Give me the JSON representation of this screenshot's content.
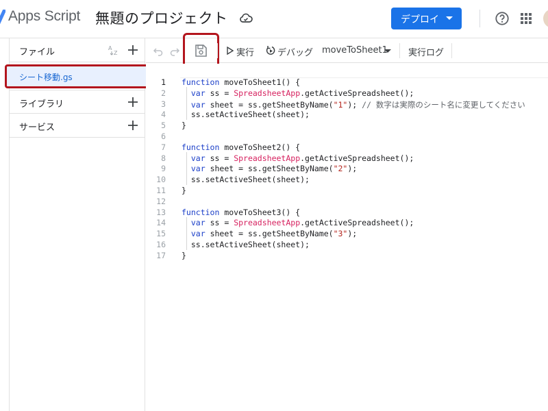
{
  "header": {
    "app_title": "Apps Script",
    "project_title": "無題のプロジェクト",
    "deploy_label": "デプロイ"
  },
  "sidebar": {
    "files_label": "ファイル",
    "sort_label": "AZ",
    "file_item": "シート移動.gs",
    "library_label": "ライブラリ",
    "services_label": "サービス"
  },
  "toolbar": {
    "run_label": "実行",
    "debug_label": "デバッグ",
    "function_select": "moveToSheet1",
    "log_label": "実行ログ"
  },
  "code": {
    "line_numbers": [
      "1",
      "2",
      "3",
      "4",
      "5",
      "6",
      "7",
      "8",
      "9",
      "10",
      "11",
      "12",
      "13",
      "14",
      "15",
      "16",
      "17"
    ],
    "lines": [
      [
        {
          "t": "function",
          "c": "kw"
        },
        {
          "t": " moveToSheet1() {"
        }
      ],
      [
        {
          "t": "  "
        },
        {
          "t": "var",
          "c": "kw"
        },
        {
          "t": " ss = "
        },
        {
          "t": "SpreadsheetApp",
          "c": "cls"
        },
        {
          "t": ".getActiveSpreadsheet();"
        }
      ],
      [
        {
          "t": "  "
        },
        {
          "t": "var",
          "c": "kw"
        },
        {
          "t": " sheet = ss.getSheetByName("
        },
        {
          "t": "\"1\"",
          "c": "str"
        },
        {
          "t": "); "
        },
        {
          "t": "// 数字は実際のシート名に変更してください",
          "c": "cmt"
        }
      ],
      [
        {
          "t": "  ss.setActiveSheet(sheet);"
        }
      ],
      [
        {
          "t": "}"
        }
      ],
      [
        {
          "t": ""
        }
      ],
      [
        {
          "t": "function",
          "c": "kw"
        },
        {
          "t": " moveToSheet2() {"
        }
      ],
      [
        {
          "t": "  "
        },
        {
          "t": "var",
          "c": "kw"
        },
        {
          "t": " ss = "
        },
        {
          "t": "SpreadsheetApp",
          "c": "cls"
        },
        {
          "t": ".getActiveSpreadsheet();"
        }
      ],
      [
        {
          "t": "  "
        },
        {
          "t": "var",
          "c": "kw"
        },
        {
          "t": " sheet = ss.getSheetByName("
        },
        {
          "t": "\"2\"",
          "c": "str"
        },
        {
          "t": ");"
        }
      ],
      [
        {
          "t": "  ss.setActiveSheet(sheet);"
        }
      ],
      [
        {
          "t": "}"
        }
      ],
      [
        {
          "t": ""
        }
      ],
      [
        {
          "t": "function",
          "c": "kw"
        },
        {
          "t": " moveToSheet3() {"
        }
      ],
      [
        {
          "t": "  "
        },
        {
          "t": "var",
          "c": "kw"
        },
        {
          "t": " ss = "
        },
        {
          "t": "SpreadsheetApp",
          "c": "cls"
        },
        {
          "t": ".getActiveSpreadsheet();"
        }
      ],
      [
        {
          "t": "  "
        },
        {
          "t": "var",
          "c": "kw"
        },
        {
          "t": " sheet = ss.getSheetByName("
        },
        {
          "t": "\"3\"",
          "c": "str"
        },
        {
          "t": ");"
        }
      ],
      [
        {
          "t": "  ss.setActiveSheet(sheet);"
        }
      ],
      [
        {
          "t": "}"
        }
      ]
    ]
  },
  "colors": {
    "accent": "#1a73e8",
    "highlight_border": "#b3151d",
    "keyword": "#1a3ec8",
    "class": "#d6215f",
    "string": "#b3261e"
  },
  "icons": [
    "apps-script-logo-icon",
    "cloud-sync-icon",
    "chevron-down-icon",
    "help-icon",
    "apps-grid-icon",
    "sort-az-icon",
    "plus-icon",
    "undo-icon",
    "redo-icon",
    "save-icon",
    "play-icon",
    "debug-icon"
  ]
}
